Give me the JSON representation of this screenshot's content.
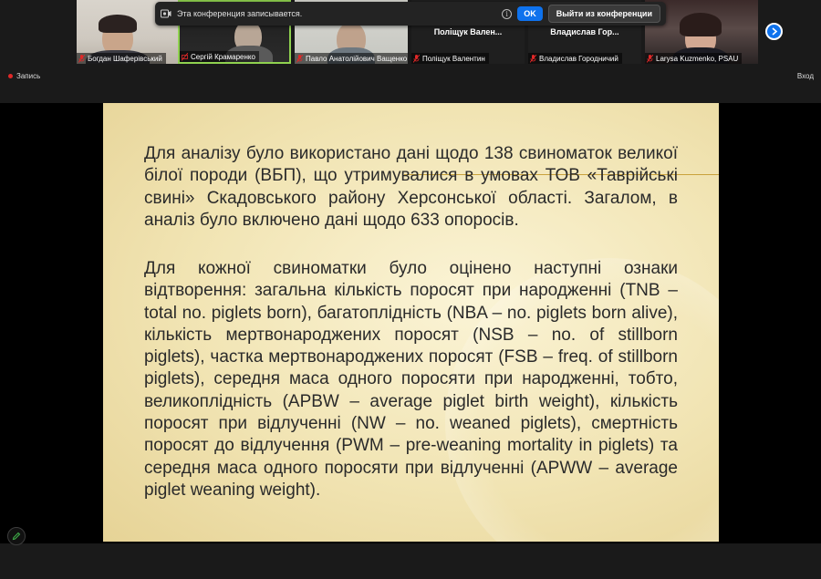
{
  "recording_banner": {
    "message": "Эта конференция записывается.",
    "ok_label": "OK",
    "leave_label": "Выйти из конференции"
  },
  "participants": [
    {
      "name": "Богдан Шаферівський",
      "center_label": "",
      "muted": true
    },
    {
      "name": "Сергій Крамаренко",
      "center_label": "",
      "muted": false
    },
    {
      "name": "Павло Анатолійович Ващенко",
      "center_label": "",
      "muted": true
    },
    {
      "name": "Поліщук Валентин",
      "center_label": "Поліщук Вален...",
      "muted": true
    },
    {
      "name": "Владислав Городничий",
      "center_label": "Владислав Гор...",
      "muted": true
    },
    {
      "name": "Larysa Kuzmenko, PSAU",
      "center_label": "",
      "muted": true
    }
  ],
  "status": {
    "recording_label": "Запись",
    "exit_label": "Вход"
  },
  "slide": {
    "paragraph1": "Для аналізу було використано дані щодо 138 свиноматок великої білої породи (ВБП), що утримувалися в умовах ТОВ «Таврійські свині» Скадовського району Херсонської області.  Загалом, в аналіз було включено дані щодо 633 опоросів.",
    "paragraph2": "Для кожної свиноматки було оцінено наступні ознаки відтворення: загальна кількість поросят при народженні (TNB – total no. piglets born), багатоплідність (NBA – no. piglets born alive), кількість мертвонароджених поросят (NSB – no. of stillborn piglets), частка мертвонароджених поросят (FSB – freq. of stillborn piglets), середня маса одного поросяти при народженні, тобто, великоплідність (APBW – average piglet birth weight), кількість поросят при відлученні (NW – no. weaned piglets), смертність поросят до відлучення (PWM – pre-weaning mortality in piglets) та середня маса одного поросяти при відлученні (APWW – average piglet weaning weight)."
  },
  "colors": {
    "accent": "#0e72ed",
    "recording": "#e02828",
    "slide_text": "#2a2a2a"
  }
}
